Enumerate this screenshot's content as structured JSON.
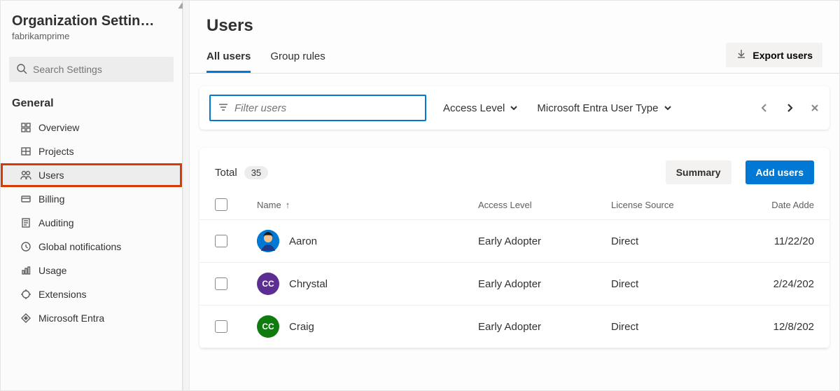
{
  "sidebar": {
    "title": "Organization Settin…",
    "subtitle": "fabrikamprime",
    "search_placeholder": "Search Settings",
    "section_label": "General",
    "items": [
      {
        "label": "Overview",
        "icon": "dashboard-icon"
      },
      {
        "label": "Projects",
        "icon": "projects-icon"
      },
      {
        "label": "Users",
        "icon": "users-icon",
        "active": true,
        "highlighted": true
      },
      {
        "label": "Billing",
        "icon": "billing-icon"
      },
      {
        "label": "Auditing",
        "icon": "auditing-icon"
      },
      {
        "label": "Global notifications",
        "icon": "notifications-icon"
      },
      {
        "label": "Usage",
        "icon": "usage-icon"
      },
      {
        "label": "Extensions",
        "icon": "extensions-icon"
      },
      {
        "label": "Microsoft Entra",
        "icon": "entra-icon"
      }
    ]
  },
  "page": {
    "title": "Users",
    "tabs": [
      {
        "label": "All users",
        "active": true
      },
      {
        "label": "Group rules",
        "active": false
      }
    ],
    "export_label": "Export users"
  },
  "filters": {
    "filter_placeholder": "Filter users",
    "dropdowns": [
      {
        "label": "Access Level"
      },
      {
        "label": "Microsoft Entra User Type"
      }
    ]
  },
  "table": {
    "total_label": "Total",
    "total_count": "35",
    "summary_label": "Summary",
    "add_label": "Add users",
    "columns": {
      "name": "Name",
      "access": "Access Level",
      "source": "License Source",
      "date": "Date Adde"
    },
    "rows": [
      {
        "name": "Aaron",
        "avatar_kind": "blue",
        "avatar_text": "",
        "access": "Early Adopter",
        "source": "Direct",
        "date": "11/22/20"
      },
      {
        "name": "Chrystal",
        "avatar_kind": "purple",
        "avatar_text": "CC",
        "access": "Early Adopter",
        "source": "Direct",
        "date": "2/24/202"
      },
      {
        "name": "Craig",
        "avatar_kind": "green",
        "avatar_text": "CC",
        "access": "Early Adopter",
        "source": "Direct",
        "date": "12/8/202"
      }
    ]
  }
}
